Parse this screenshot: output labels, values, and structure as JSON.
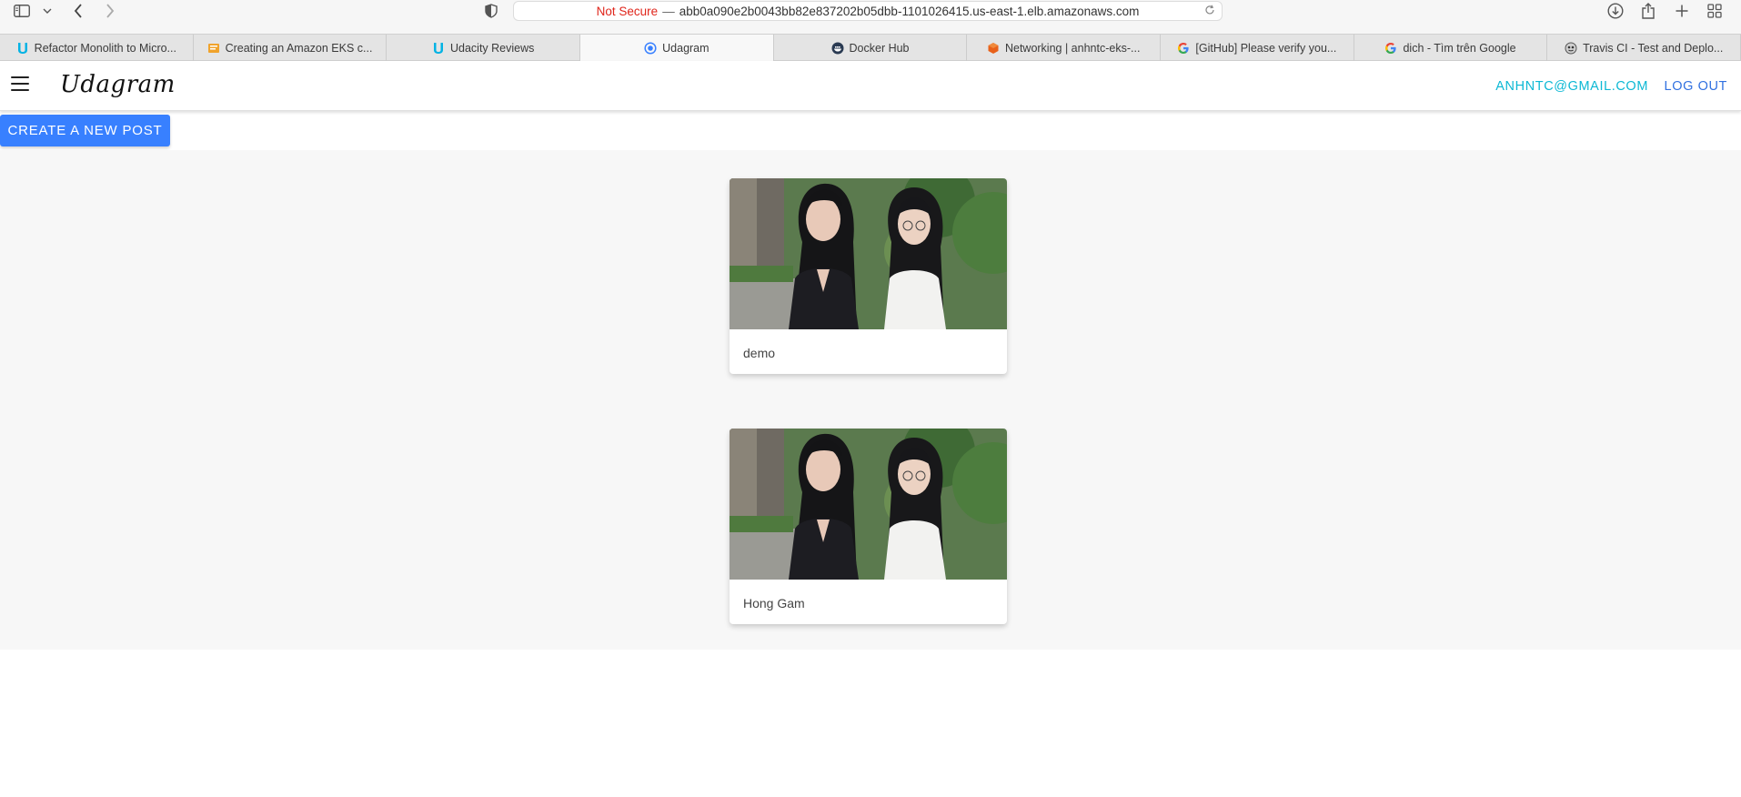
{
  "browser": {
    "url": {
      "security_label": "Not Secure",
      "separator": "—",
      "host": "abb0a090e2b0043bb82e837202b05dbb-1101026415.us-east-1.elb.amazonaws.com"
    },
    "tabs": [
      {
        "label": "Refactor Monolith to Micro...",
        "icon": "udacity-icon",
        "active": false
      },
      {
        "label": "Creating an Amazon EKS c...",
        "icon": "aws-docs-icon",
        "active": false
      },
      {
        "label": "Udacity Reviews",
        "icon": "udacity-icon",
        "active": false
      },
      {
        "label": "Udagram",
        "icon": "ionic-icon",
        "active": true
      },
      {
        "label": "Docker Hub",
        "icon": "docker-icon",
        "active": false
      },
      {
        "label": "Networking | anhntc-eks-...",
        "icon": "aws-icon",
        "active": false
      },
      {
        "label": "[GitHub] Please verify you...",
        "icon": "google-icon",
        "active": false
      },
      {
        "label": "dich - Tìm trên Google",
        "icon": "google-icon",
        "active": false
      },
      {
        "label": "Travis CI - Test and Deplo...",
        "icon": "travis-icon",
        "active": false
      }
    ]
  },
  "app": {
    "brand": "Udagram",
    "user_email": "ANHNTC@GMAIL.COM",
    "logout_label": "LOG OUT",
    "create_post_label": "CREATE A NEW POST"
  },
  "feed": {
    "posts": [
      {
        "caption": "demo"
      },
      {
        "caption": "Hong Gam"
      }
    ]
  },
  "colors": {
    "primary": "#3880ff",
    "email_link": "#0cb8d4",
    "logout_link": "#3171e0",
    "not_secure": "#e0251b",
    "feed_background": "#f7f7f7"
  }
}
